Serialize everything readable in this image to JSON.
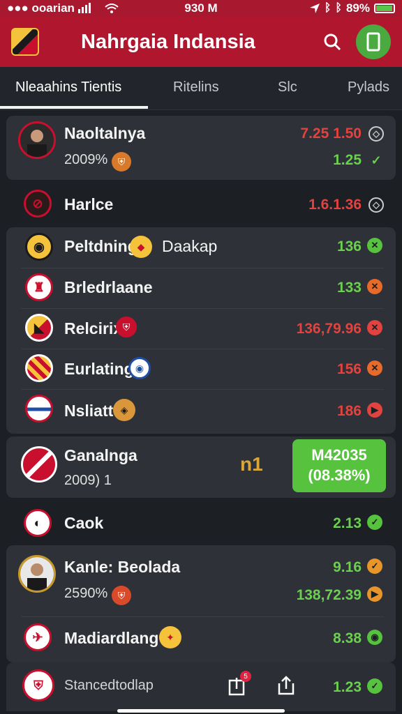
{
  "status_bar": {
    "carrier": "●●● ooarian",
    "time": "930 M",
    "battery": "89%",
    "battery_level": 0.89
  },
  "header": {
    "title": "Nahrgaia Indansia"
  },
  "tabs": [
    {
      "label": "Nleaahins Tientis",
      "active": true
    },
    {
      "label": "Ritelins",
      "active": false
    },
    {
      "label": "Slc",
      "active": false
    },
    {
      "label": "Pylads",
      "active": false
    }
  ],
  "rows": {
    "r1": {
      "name": "Naoltalnya",
      "sub": "2009%",
      "odds1": "7.25 1.50",
      "odds2": "1.25"
    },
    "r2": {
      "name": "Harlce",
      "odds": "1.6.1.36"
    },
    "r3": {
      "name": "Peltdning",
      "name2": "Daakap",
      "odds": "136"
    },
    "r4": {
      "name": "Brledrlaane",
      "odds": "133"
    },
    "r5": {
      "name": "Relcirix",
      "odds": "136,79.96"
    },
    "r6": {
      "name": "Eurlating",
      "odds": "156"
    },
    "r7": {
      "name": "Nsliatt",
      "odds": "186"
    },
    "r8": {
      "name": "Ganalnga",
      "sub": "2009) 1",
      "mid": "n1",
      "btn_line1": "M42035",
      "btn_line2": "(08.38%)"
    },
    "r9": {
      "name": "Caok",
      "odds": "2.13"
    },
    "r10": {
      "name": "Kanle: Beolada",
      "sub": "2590%",
      "odds1": "9.16",
      "odds2": "138,72.39"
    },
    "r11": {
      "name": "Madiardlang",
      "odds": "8.38"
    },
    "bottom": {
      "label": "Stancedtodlap",
      "odds": "1.23",
      "notif": "5"
    }
  },
  "colors": {
    "brand": "#b0162e",
    "positive": "#6bcf4f",
    "negative": "#e2433f",
    "card": "#2e3137",
    "background": "#1c1f24"
  }
}
